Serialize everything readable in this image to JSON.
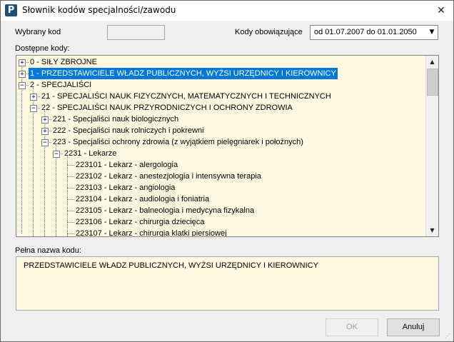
{
  "window": {
    "title": "Słownik kodów specjalności/zawodu",
    "app_icon_letter": "P",
    "close_glyph": "✕"
  },
  "form": {
    "selected_code_label": "Wybrany kod",
    "selected_code_value": "",
    "valid_codes_label": "Kody obowiązujące",
    "valid_codes_value": "od 01.07.2007 do 01.01.2050",
    "available_codes_label": "Dostępne kody:",
    "full_name_label": "Pełna nazwa kodu:",
    "full_name_value": "PRZEDSTAWICIELE WŁADZ PUBLICZNYCH, WYŻSI URZĘDNICY I KIEROWNICY"
  },
  "tree": {
    "nodes": [
      {
        "label": "0 - SIŁY ZBROJNE",
        "expander": "+"
      },
      {
        "label": "1 - PRZEDSTAWICIELE WŁADZ PUBLICZNYCH, WYŻSI URZĘDNICY I KIEROWNICY",
        "expander": "+",
        "selected": true
      },
      {
        "label": "2 - SPECJALIŚCI",
        "expander": "−"
      },
      {
        "label": "21 - SPECJALIŚCI NAUK FIZYCZNYCH, MATEMATYCZNYCH I TECHNICZNYCH",
        "expander": "+"
      },
      {
        "label": "22 - SPECJALIŚCI NAUK PRZYRODNICZYCH I OCHRONY ZDROWIA",
        "expander": "−"
      },
      {
        "label": "221 - Specjaliści nauk biologicznych",
        "expander": "+"
      },
      {
        "label": "222 - Specjaliści nauk rolniczych i pokrewni",
        "expander": "+"
      },
      {
        "label": "223 - Specjaliści ochrony zdrowia (z wyjątkiem pielęgniarek i położnych)",
        "expander": "−"
      },
      {
        "label": "2231 - Lekarze",
        "expander": "−"
      },
      {
        "label": "223101 - Lekarz - alergologia"
      },
      {
        "label": "223102 - Lekarz - anestezjologia i intensywna terapia"
      },
      {
        "label": "223103 - Lekarz - angiologia"
      },
      {
        "label": "223104 - Lekarz - audiologia i foniatria"
      },
      {
        "label": "223105 - Lekarz - balneologia i medycyna fizykalna"
      },
      {
        "label": "223106 - Lekarz - chirurgia dziecięca"
      },
      {
        "label": "223107 - Lekarz - chirurgia klatki piersiowej"
      }
    ]
  },
  "buttons": {
    "ok": "OK",
    "cancel": "Anuluj"
  },
  "icons": {
    "combo_arrow": "▼",
    "scroll_up": "▲",
    "scroll_down": "▼",
    "grip": "⋰"
  }
}
